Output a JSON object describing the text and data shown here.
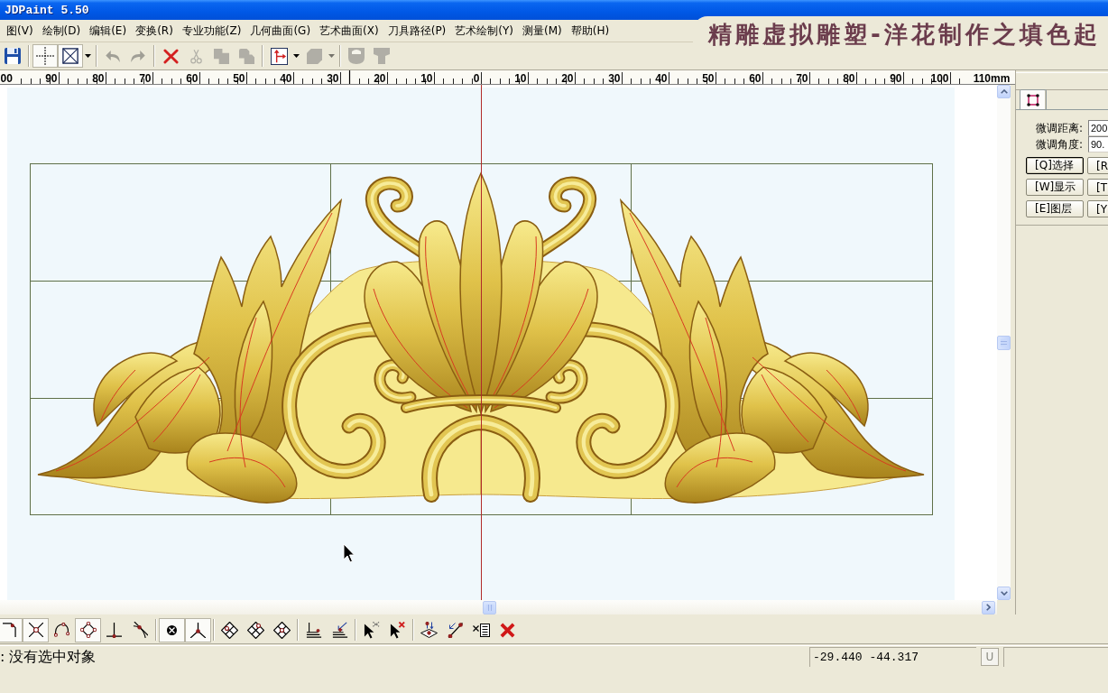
{
  "window": {
    "title": "JDPaint 5.50"
  },
  "caption": "精雕虚拟雕塑-洋花制作之填色起",
  "menu_bar": [
    "图(V)",
    "绘制(D)",
    "编辑(E)",
    "变换(R)",
    "专业功能(Z)",
    "几何曲面(G)",
    "艺术曲面(X)",
    "刀具路径(P)",
    "艺术绘制(Y)",
    "测量(M)",
    "帮助(H)"
  ],
  "toolbar": [
    {
      "kind": "button",
      "pressed": false,
      "disabled": false
    },
    {
      "kind": "separator"
    },
    {
      "kind": "button",
      "pressed": true,
      "disabled": false
    },
    {
      "kind": "button",
      "pressed": true,
      "disabled": false
    },
    {
      "kind": "dropdown",
      "pressed": false,
      "disabled": false
    },
    {
      "kind": "separator"
    },
    {
      "kind": "button",
      "pressed": false,
      "disabled": true
    },
    {
      "kind": "button",
      "pressed": false,
      "disabled": true
    },
    {
      "kind": "separator"
    },
    {
      "kind": "button",
      "pressed": false,
      "disabled": false
    },
    {
      "kind": "button",
      "pressed": false,
      "disabled": true
    },
    {
      "kind": "button",
      "pressed": false,
      "disabled": true
    },
    {
      "kind": "button",
      "pressed": false,
      "disabled": true
    },
    {
      "kind": "separator"
    },
    {
      "kind": "button",
      "pressed": false,
      "disabled": false
    },
    {
      "kind": "dropdown",
      "pressed": false,
      "disabled": false
    },
    {
      "kind": "button",
      "pressed": false,
      "disabled": true
    },
    {
      "kind": "dropdown",
      "pressed": false,
      "disabled": true
    },
    {
      "kind": "separator"
    },
    {
      "kind": "button",
      "pressed": false,
      "disabled": true
    },
    {
      "kind": "button",
      "pressed": false,
      "disabled": true
    }
  ],
  "ruler": {
    "labels": [
      "00",
      "90",
      "80",
      "70",
      "60",
      "50",
      "40",
      "30",
      "20",
      "10",
      "0",
      "10",
      "20",
      "30",
      "40",
      "50",
      "60",
      "70",
      "80",
      "90",
      "100",
      "110mm"
    ]
  },
  "side_panel": {
    "tabs": [
      {
        "selected": true
      }
    ],
    "fields": [
      {
        "label": "微调距离:",
        "value": "200"
      },
      {
        "label": "微调角度:",
        "value": "90."
      }
    ],
    "buttons": [
      {
        "label": "[Q]选择",
        "focused": true
      },
      {
        "label": "[R",
        "focused": false
      },
      {
        "label": "[W]显示",
        "focused": false
      },
      {
        "label": "[T",
        "focused": false
      },
      {
        "label": "[E]图层",
        "focused": false
      },
      {
        "label": "[Y",
        "focused": false
      }
    ]
  },
  "snap_toolbar": [
    {
      "kind": "button",
      "pressed": true
    },
    {
      "kind": "button",
      "pressed": true
    },
    {
      "kind": "button",
      "pressed": false
    },
    {
      "kind": "button",
      "pressed": true
    },
    {
      "kind": "button",
      "pressed": false
    },
    {
      "kind": "button",
      "pressed": false
    },
    {
      "kind": "separator"
    },
    {
      "kind": "button",
      "pressed": true
    },
    {
      "kind": "button",
      "pressed": true
    },
    {
      "kind": "separator"
    },
    {
      "kind": "button",
      "pressed": false
    },
    {
      "kind": "button",
      "pressed": false
    },
    {
      "kind": "button",
      "pressed": false
    },
    {
      "kind": "separator"
    },
    {
      "kind": "button",
      "pressed": false
    },
    {
      "kind": "button",
      "pressed": false
    },
    {
      "kind": "separator"
    },
    {
      "kind": "button",
      "pressed": false
    },
    {
      "kind": "button",
      "pressed": false
    },
    {
      "kind": "separator"
    },
    {
      "kind": "button",
      "pressed": false
    },
    {
      "kind": "button",
      "pressed": false
    },
    {
      "kind": "button",
      "pressed": false
    },
    {
      "kind": "button",
      "pressed": false
    }
  ],
  "status_bar": {
    "message": ": 没有选中对象",
    "coordinates": "-29.440 -44.317",
    "button": "U"
  }
}
